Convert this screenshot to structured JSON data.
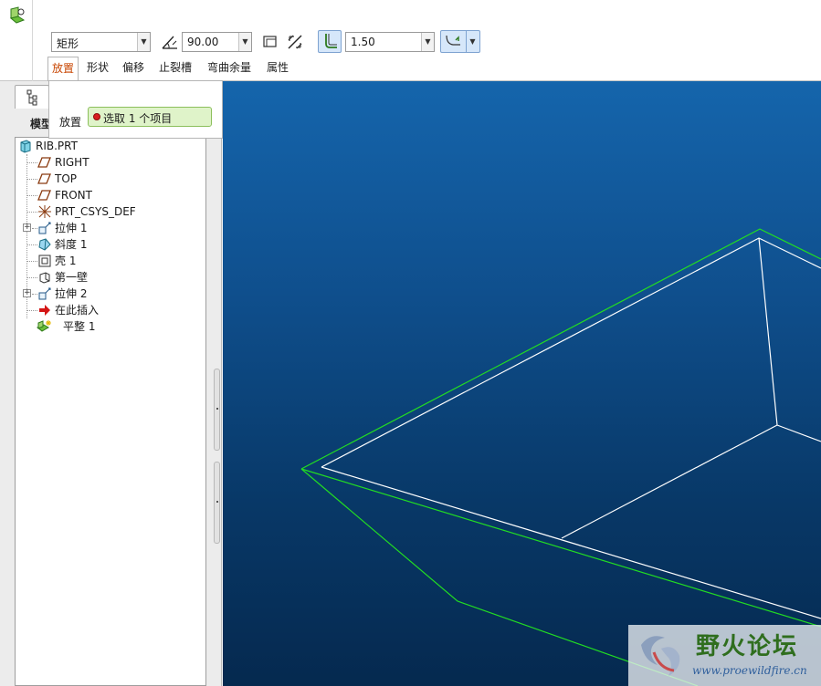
{
  "dashboard": {
    "shape_value": "矩形",
    "angle_value": "90.00",
    "radius_value": "1.50",
    "tabs": [
      {
        "label": "放置",
        "active": true
      },
      {
        "label": "形状"
      },
      {
        "label": "偏移"
      },
      {
        "label": "止裂槽"
      },
      {
        "label": "弯曲余量"
      },
      {
        "label": "属性"
      }
    ]
  },
  "placement_panel": {
    "label": "放置",
    "collector_text": "选取 1 个项目"
  },
  "model_tree": {
    "header": "模型",
    "items": [
      {
        "label": "RIB.PRT",
        "icon": "part-icon"
      },
      {
        "label": "RIGHT",
        "icon": "datum-plane-icon"
      },
      {
        "label": "TOP",
        "icon": "datum-plane-icon"
      },
      {
        "label": "FRONT",
        "icon": "datum-plane-icon"
      },
      {
        "label": "PRT_CSYS_DEF",
        "icon": "csys-icon"
      },
      {
        "label": "拉伸 1",
        "icon": "extrude-icon"
      },
      {
        "label": "斜度 1",
        "icon": "draft-icon"
      },
      {
        "label": "壳 1",
        "icon": "shell-icon"
      },
      {
        "label": "第一壁",
        "icon": "first-wall-icon"
      },
      {
        "label": "拉伸 2",
        "icon": "extrude-icon"
      },
      {
        "label": "在此插入",
        "icon": "insert-here-arrow-icon"
      },
      {
        "label": "平整 1",
        "icon": "flat-wall-icon"
      }
    ]
  },
  "watermark": {
    "title": "野火论坛",
    "url": "www.proewildfire.cn"
  },
  "colors": {
    "geometry_green": "#22dd22",
    "geometry_white": "#ffffff",
    "active_tab": "#c84500",
    "collector_bg": "#dff3c9"
  }
}
